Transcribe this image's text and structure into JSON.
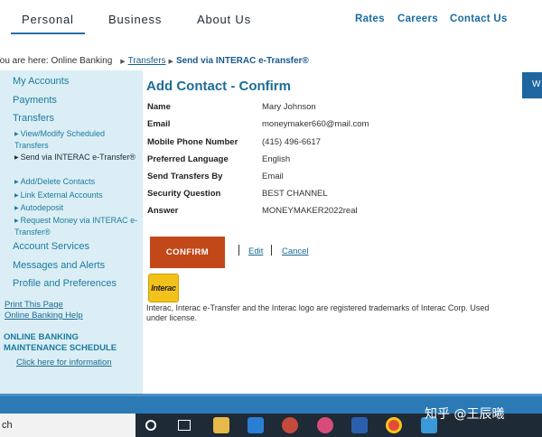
{
  "topnav": {
    "tabs": [
      "Personal",
      "Business",
      "About Us"
    ],
    "links": [
      "Rates",
      "Careers",
      "Contact Us"
    ]
  },
  "breadcrumb": {
    "prefix": "You are here: Online Banking",
    "link": "Transfers",
    "current": "Send via INTERAC e-Transfer®"
  },
  "sidebar": {
    "main1": [
      "My Accounts",
      "Payments",
      "Transfers"
    ],
    "sub": [
      "View/Modify Scheduled Transfers",
      "Send via INTERAC e-Transfer®",
      "Add/Delete Contacts",
      "Link External Accounts",
      "Autodeposit",
      "Request Money via INTERAC e-Transfer®"
    ],
    "main2": [
      "Account Services",
      "Messages and Alerts",
      "Profile and Preferences"
    ],
    "util": [
      "Print This Page",
      "Online Banking Help"
    ],
    "heading": "ONLINE BANKING MAINTENANCE SCHEDULE",
    "footer_link": "Click here for information"
  },
  "main": {
    "title": "Add Contact - Confirm",
    "fields": [
      {
        "label": "Name",
        "value": "Mary Johnson"
      },
      {
        "label": "Email",
        "value": "moneymaker660@mail.com"
      },
      {
        "label": "Mobile Phone Number",
        "value": "(415) 496-6617"
      },
      {
        "label": "Preferred Language",
        "value": "English"
      },
      {
        "label": "Send Transfers By",
        "value": "Email"
      },
      {
        "label": "Security Question",
        "value": "BEST CHANNEL"
      },
      {
        "label": "Answer",
        "value": "MONEYMAKER2022real"
      }
    ],
    "confirm_label": "CONFIRM",
    "edit_label": "Edit",
    "cancel_label": "Cancel",
    "logo_text": "Interac",
    "legal": "Interac, Interac e-Transfer and the Interac logo are registered trademarks of Interac Corp. Used under license."
  },
  "right_tab": "W",
  "taskbar": {
    "search_text": "ch",
    "watermark": "知乎 @王辰曦"
  },
  "colors": {
    "accent": "#1b6e96",
    "sidebar_bg": "#dbeef5",
    "confirm_bg": "#c2481a",
    "taskbar_bg": "#1e2a35"
  }
}
